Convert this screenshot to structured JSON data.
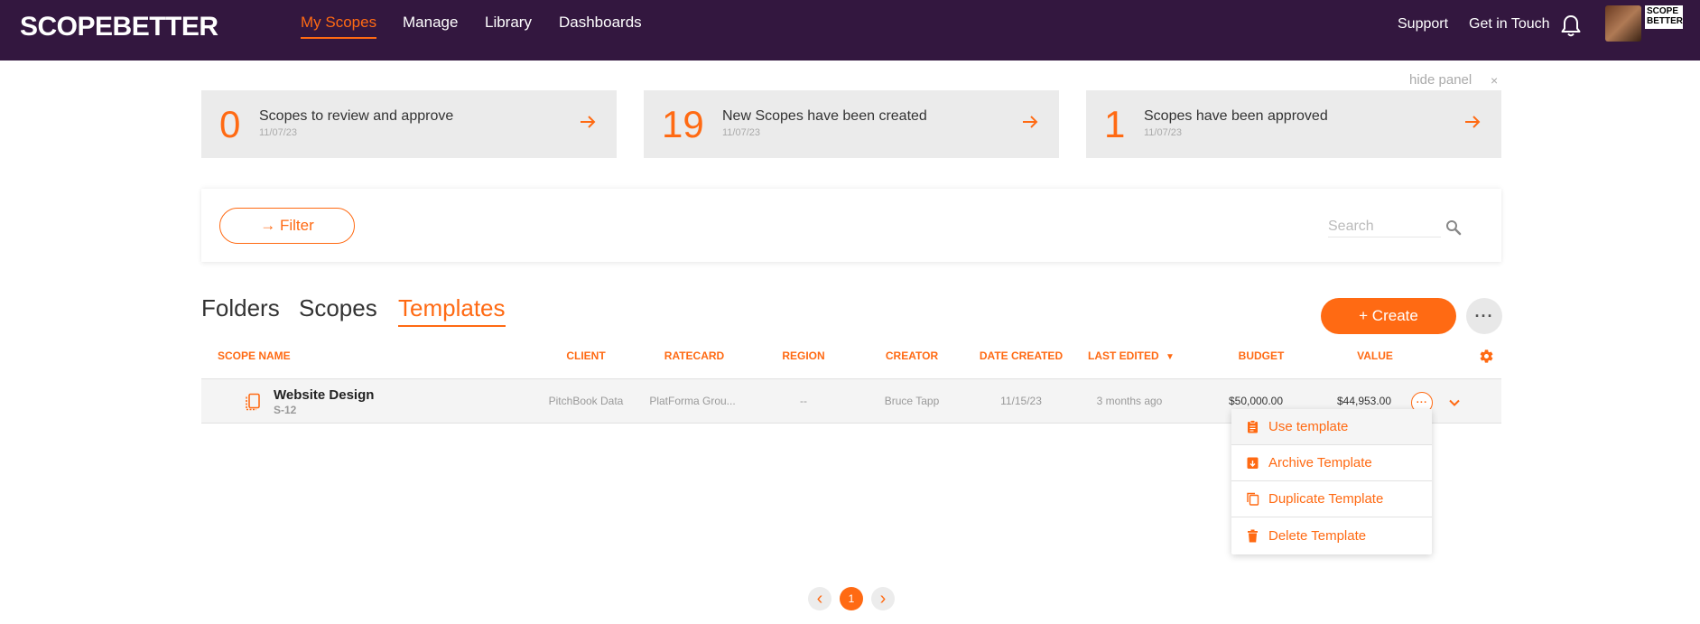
{
  "header": {
    "logo_text": "SCOPEBETTER",
    "nav": [
      "My Scopes",
      "Manage",
      "Library",
      "Dashboards"
    ],
    "active_nav": "My Scopes",
    "links": [
      "Support",
      "Get in Touch"
    ],
    "mini_logo": "SCOPE BETTER"
  },
  "panel": {
    "hide_label": "hide panel",
    "close_glyph": "×",
    "cards": [
      {
        "count": "0",
        "label": "Scopes to review and approve",
        "date": "11/07/23"
      },
      {
        "count": "19",
        "label": "New Scopes have been created",
        "date": "11/07/23"
      },
      {
        "count": "1",
        "label": "Scopes have been approved",
        "date": "11/07/23"
      }
    ]
  },
  "filter": {
    "button_label": "→ Filter",
    "search_placeholder": "Search"
  },
  "tabs": {
    "items": [
      "Folders",
      "Scopes",
      "Templates"
    ],
    "active": "Templates",
    "create_label": "+ Create",
    "more_glyph": "···"
  },
  "table": {
    "columns": [
      "SCOPE NAME",
      "CLIENT",
      "RATECARD",
      "REGION",
      "CREATOR",
      "DATE CREATED",
      "LAST EDITED",
      "BUDGET",
      "VALUE"
    ],
    "sort_indicator": "▼",
    "rows": [
      {
        "name": "Website Design",
        "id": "S-12",
        "client": "PitchBook Data",
        "ratecard": "PlatForma Grou...",
        "region": "--",
        "creator": "Bruce Tapp",
        "date_created": "11/15/23",
        "last_edited": "3 months ago",
        "budget": "$50,000.00",
        "value": "$44,953.00"
      }
    ],
    "row_actions_glyph": "···"
  },
  "row_menu": {
    "items": [
      "Use template",
      "Archive Template",
      "Duplicate Template",
      "Delete Template"
    ]
  },
  "pagination": {
    "current": "1",
    "prev_glyph": "‹",
    "next_glyph": "›"
  },
  "colors": {
    "accent": "#ff6a13",
    "header_bg": "#33173f"
  }
}
